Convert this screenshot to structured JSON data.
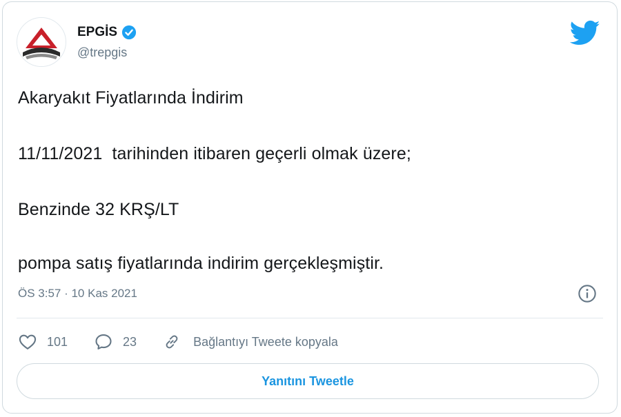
{
  "author": {
    "name": "EPGİS",
    "handle": "@trepgis",
    "verified": true
  },
  "icons": {
    "platform": "twitter-bird-icon",
    "verified": "verified-badge-icon",
    "info": "info-icon",
    "like": "heart-icon",
    "reply": "reply-bubble-icon",
    "copy_link": "link-icon"
  },
  "tweet": {
    "lines": [
      "Akaryakıt Fiyatlarında İndirim",
      "11/11/2021  tarihinden itibaren geçerli olmak üzere;",
      "Benzinde 32 KRŞ/LT",
      "pompa satış fiyatlarında indirim gerçekleşmiştir."
    ],
    "timestamp": "ÖS 3:57 · 10 Kas 2021"
  },
  "actions": {
    "likes": "101",
    "replies": "23",
    "copy_link_label": "Bağlantıyı Tweete kopyala"
  },
  "reply_button": {
    "label": "Yanıtını Tweetle"
  },
  "colors": {
    "accent": "#1b95e0",
    "twitter_blue": "#1da1f2",
    "secondary_text": "#657786",
    "border": "#cfd9de",
    "logo_red": "#c8202a"
  }
}
